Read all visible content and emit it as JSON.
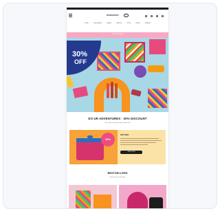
{
  "site": {
    "logo_text": "WONDERBOX",
    "nav": [
      "HOME",
      "CALENDARS",
      "GAMES",
      "SNACKS",
      "GIFTS",
      "DEALS",
      "BRANDS"
    ],
    "announcement": "SHOP THE SALE"
  },
  "hero": {
    "discount_percent": "30%",
    "discount_word": "OFF"
  },
  "headline": {
    "title": "DO UR ADVENTURES · 30% DISCOUNT",
    "subtitle": "Use code at checkout while stocks last"
  },
  "promo": {
    "tag": "30%",
    "title": "GIFT BOX",
    "button_label": "SHOP NOW"
  },
  "section2": {
    "title": "BESTSELLERS",
    "subtitle": "Find your new favourite"
  },
  "colors": {
    "hero_bg": "#a8d7e6",
    "badge": "#243a8f",
    "accent_pink": "#ef4c7f",
    "promo_bg": "#fbe3a8"
  }
}
